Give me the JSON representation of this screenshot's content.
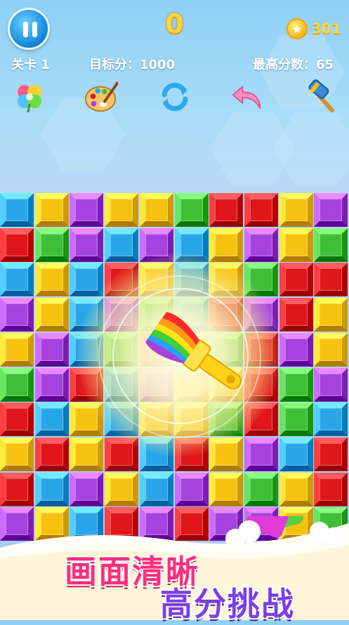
{
  "header": {
    "score": "0",
    "coins": "301",
    "level_label": "关卡 1",
    "target_label": "目标分：1000",
    "high_score_label": "最高分数：65"
  },
  "tools": [
    {
      "name": "clover-icon"
    },
    {
      "name": "paint-palette-icon"
    },
    {
      "name": "refresh-icon"
    },
    {
      "name": "undo-icon"
    },
    {
      "name": "hammer-icon"
    }
  ],
  "colors": {
    "red": "#e0161a",
    "yellow": "#f7c20f",
    "green": "#3fbf36",
    "blue": "#2aa6e8",
    "purple": "#a643de",
    "cyan": "#34c7dd"
  },
  "board": [
    "BYPYYGRRYP",
    "RGPBPBYPYG",
    "BYBRYBYGRR",
    "PYBPGBRPRY",
    "YPBGRYGRPY",
    "GPRBPYYRGP",
    "RBYBYYGRGB",
    "YRYRBRYPBR",
    "RBPYBPYGYR",
    "PYBRPRPPYG"
  ],
  "slogan": {
    "line1": "画面清晰",
    "line2": "高分挑战"
  }
}
